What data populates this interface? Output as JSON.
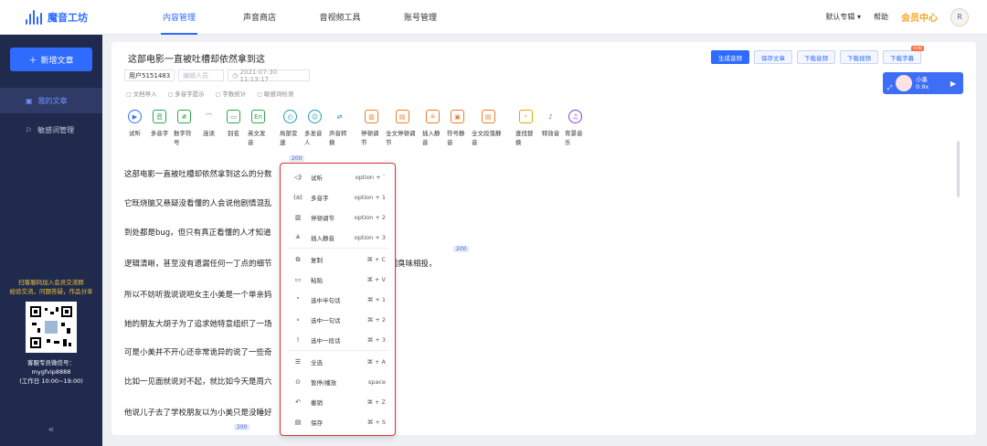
{
  "app": {
    "name": "魔音工坊"
  },
  "nav": [
    "内容管理",
    "声音商店",
    "音视频工具",
    "账号管理"
  ],
  "top_right": {
    "album": "默认专辑",
    "help": "帮助",
    "vip": "会员中心",
    "avatar_text": "R"
  },
  "sidebar": {
    "new_button": "新增文章",
    "items": [
      {
        "label": "我的文章"
      },
      {
        "label": "敏感词管理"
      }
    ],
    "promo": [
      "扫客服码加入会员交流群",
      "经验交流，问题答疑，作品分享"
    ],
    "cs": [
      "客服专员微信号：",
      "mygfvip8888",
      "(工作日 10:00~19:00)"
    ],
    "collapse": "«"
  },
  "doc": {
    "title": "这部电影一直被吐槽却依然拿到这",
    "user": "用户5151483",
    "editor_placeholder": "编辑人员",
    "date": "2021-07-30 11:13:17",
    "sub": [
      "文档导入",
      "多音字提示",
      "字数统计",
      "敏感词检测"
    ]
  },
  "buttons": {
    "generate": "生成音频",
    "save": "保存文章",
    "dl_audio": "下载音频",
    "dl_video": "下载视频",
    "dl_sub": "下载字幕",
    "svip": "svip"
  },
  "voice": {
    "name": "小墨",
    "speed": "0.9x"
  },
  "toolbar": [
    "试听",
    "多音字",
    "数字符号",
    "连读",
    "别名",
    "英文发音",
    "局部变速",
    "多发音人",
    "声音转换",
    "停顿调节",
    "全文停顿调节",
    "插入静音",
    "符号静音",
    "全文段落静音",
    "查找替换",
    "特效音",
    "背景音乐"
  ],
  "badge": "200",
  "paragraphs": [
    "这部电影一直被吐槽却依然拿到这么的分数",
    "它既烧脑又悬疑没看懂的人会说他剧情混乱",
    "到处都是bug，但只有真正看懂的人才知道",
    "逻辑清晰，甚至没有遗漏任何一丁点的细节",
    "所以不妨听我说说吧女主小美是一个单亲妈",
    "她的朋友大胡子为了追求她特意组织了一场",
    "可是小美并不开心还非常诡异的说了一些奇",
    "比如一见面就说对不起，就比如今天是周六",
    "他说儿子去了学校朋友以为小美只是没睡好"
  ],
  "para_tail": "我们臭味相投，",
  "context_menu": [
    {
      "icon": "speaker-icon",
      "glyph": "◁)",
      "label": "试听",
      "key": "option + `"
    },
    {
      "icon": "polyphone-icon",
      "glyph": "(a)",
      "label": "多音字",
      "key": "option + 1"
    },
    {
      "icon": "pause-adjust-icon",
      "glyph": "▥",
      "label": "停顿调节",
      "key": "option + 2"
    },
    {
      "icon": "insert-silence-icon",
      "glyph": "≗",
      "label": "插入静音",
      "key": "option + 3"
    },
    {
      "icon": "copy-icon",
      "glyph": "⧉",
      "label": "复制",
      "key": "⌘ + C"
    },
    {
      "icon": "paste-icon",
      "glyph": "▭",
      "label": "粘贴",
      "key": "⌘ + V"
    },
    {
      "icon": "half-sentence-icon",
      "glyph": "❜",
      "label": "选中半句话",
      "key": "⌘ + 1"
    },
    {
      "icon": "sentence-icon",
      "glyph": "∘",
      "label": "选中一句话",
      "key": "⌘ + 2"
    },
    {
      "icon": "paragraph-icon",
      "glyph": "!",
      "label": "选中一段话",
      "key": "⌘ + 3"
    },
    {
      "icon": "select-all-icon",
      "glyph": "☰",
      "label": "全选",
      "key": "⌘ + A"
    },
    {
      "icon": "pause-play-icon",
      "glyph": "⊙",
      "label": "暂停/播放",
      "key": "space"
    },
    {
      "icon": "undo-icon",
      "glyph": "↶",
      "label": "撤销",
      "key": "⌘ + Z"
    },
    {
      "icon": "save-icon",
      "glyph": "▤",
      "label": "保存",
      "key": "⌘ + S"
    }
  ]
}
